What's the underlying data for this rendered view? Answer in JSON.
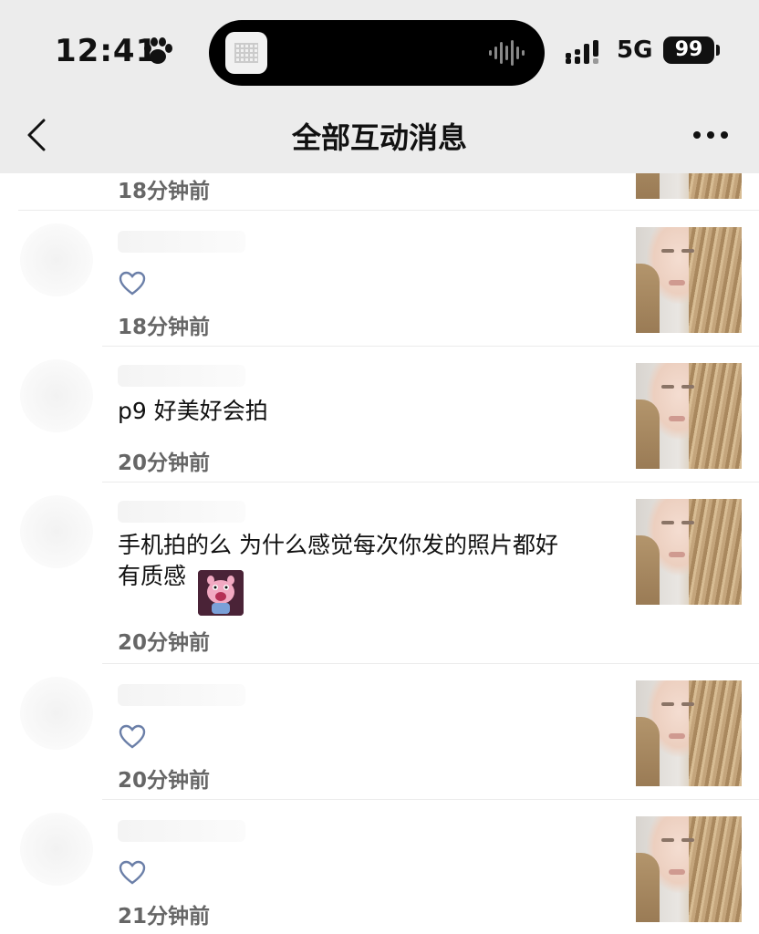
{
  "status_bar": {
    "time": "12:41",
    "network": "5G",
    "battery": "99"
  },
  "nav": {
    "title": "全部互动消息"
  },
  "items": [
    {
      "comment": "",
      "time": "18分钟前",
      "reaction": "none"
    },
    {
      "comment": "",
      "time": "18分钟前",
      "reaction": "heart-icon"
    },
    {
      "comment": "p9 好美好会拍",
      "time": "20分钟前",
      "reaction": "none"
    },
    {
      "comment_line1": "手机拍的么 为什么感觉每次你发的照片都好",
      "comment_line2": "有质感",
      "time": "20分钟前",
      "reaction": "none",
      "sticker": "pig-sticker"
    },
    {
      "comment": "",
      "time": "20分钟前",
      "reaction": "heart-icon"
    },
    {
      "comment": "",
      "time": "21分钟前",
      "reaction": "heart-icon"
    }
  ],
  "colors": {
    "bar_bg": "#ececec",
    "heart": "#6b7fa8",
    "time_text": "#666666"
  }
}
